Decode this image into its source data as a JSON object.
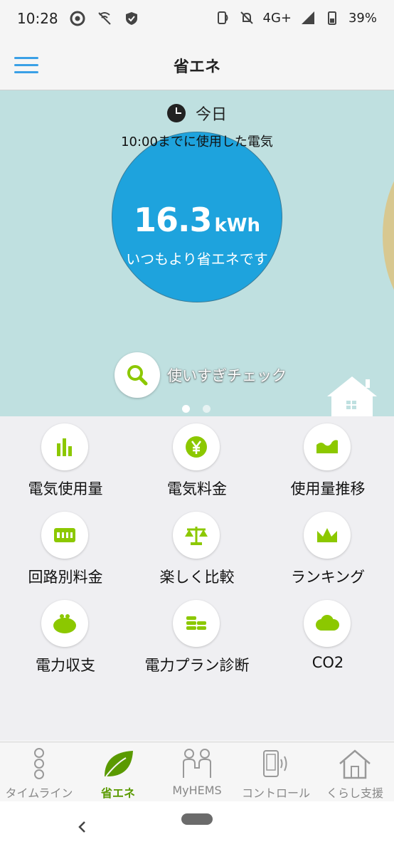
{
  "status": {
    "time": "10:28",
    "network": "4G+",
    "battery": "39%"
  },
  "app": {
    "title": "省エネ"
  },
  "hero": {
    "today_label": "今日",
    "until_text": "10:00までに使用した電気",
    "value": "16.3",
    "unit": "kWh",
    "message": "いつもより省エネです",
    "check_label": "使いすぎチェック"
  },
  "menu": {
    "items": [
      {
        "label": "電気使用量",
        "icon": "bar-chart-icon"
      },
      {
        "label": "電気料金",
        "icon": "yen-icon"
      },
      {
        "label": "使用量推移",
        "icon": "area-chart-icon"
      },
      {
        "label": "回路別料金",
        "icon": "meter-icon"
      },
      {
        "label": "楽しく比較",
        "icon": "scale-icon"
      },
      {
        "label": "ランキング",
        "icon": "crown-icon"
      },
      {
        "label": "電力収支",
        "icon": "purse-icon"
      },
      {
        "label": "電力プラン診断",
        "icon": "coins-icon"
      },
      {
        "label": "CO2",
        "icon": "cloud-icon"
      }
    ]
  },
  "tabs": [
    {
      "label": "タイムライン",
      "icon": "timeline-icon",
      "active": false
    },
    {
      "label": "省エネ",
      "icon": "leaf-icon",
      "active": true
    },
    {
      "label": "MyHEMS",
      "icon": "people-icon",
      "active": false
    },
    {
      "label": "コントロール",
      "icon": "phone-signal-icon",
      "active": false
    },
    {
      "label": "くらし支援",
      "icon": "house-icon",
      "active": false
    }
  ],
  "colors": {
    "accent_green": "#8cc800",
    "circle_blue": "#1ea3dd",
    "hero_bg": "#bfe0e0",
    "hamburger_blue": "#3aa0e6"
  }
}
